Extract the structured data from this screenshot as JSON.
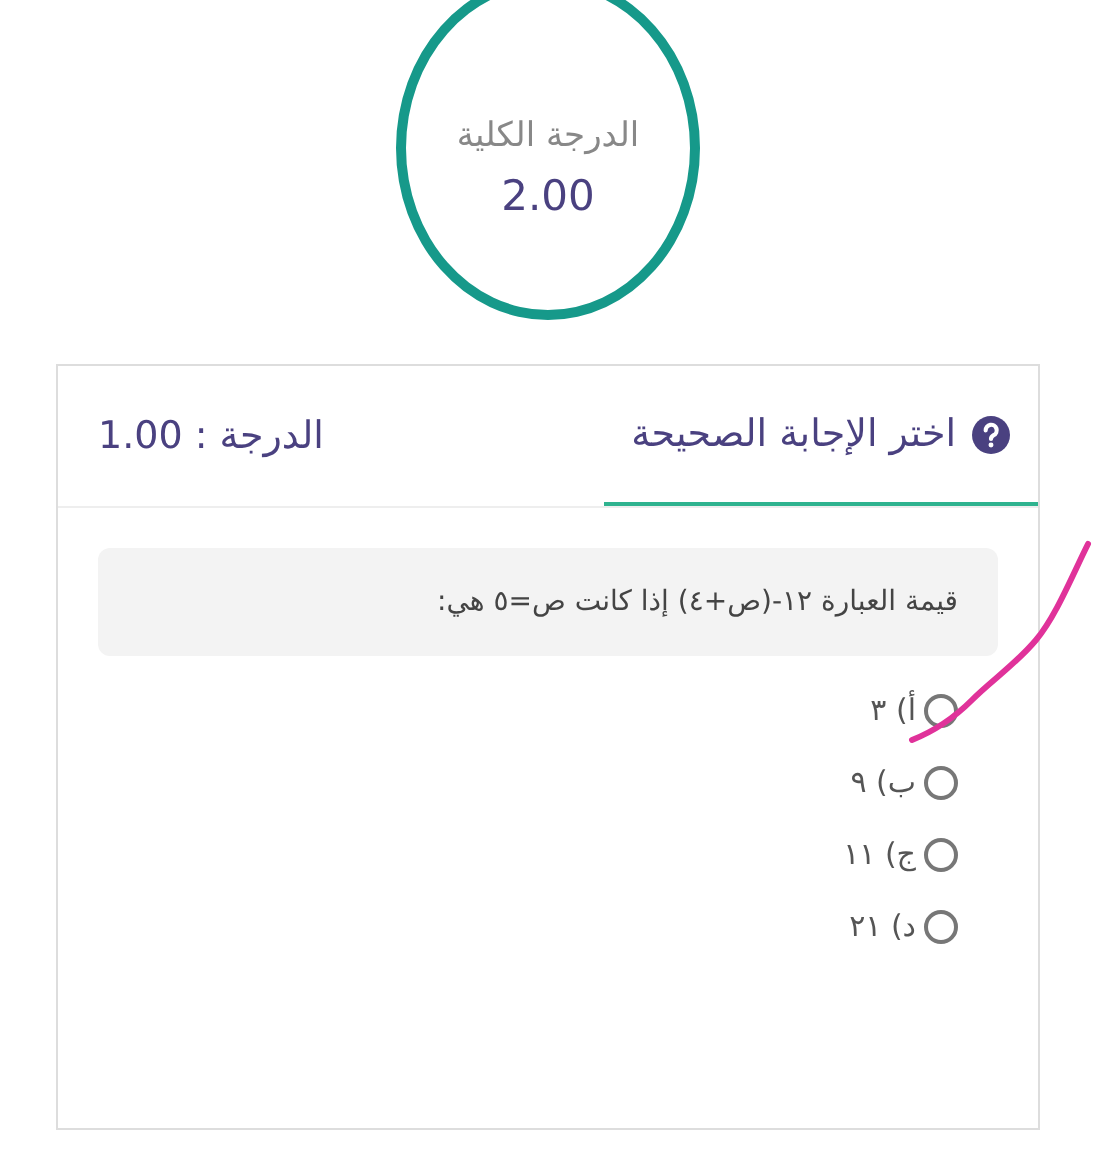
{
  "total_score": {
    "label": "الدرجة الكلية",
    "value": "2.00"
  },
  "question": {
    "tab": {
      "label": "اختر الإجابة الصحيحة",
      "selected": true
    },
    "score": "الدرجة : 1.00",
    "text": "قيمة العبارة ١٢-(ص+٤) إذا كانت ص=٥ هي:",
    "options": [
      {
        "label": "أ) ٣",
        "selected": false
      },
      {
        "label": "ب) ٩",
        "selected": false
      },
      {
        "label": "ج) ١١",
        "selected": false
      },
      {
        "label": "د) ٢١",
        "selected": false
      }
    ]
  },
  "annotation": {
    "kind": "pen_stroke"
  }
}
